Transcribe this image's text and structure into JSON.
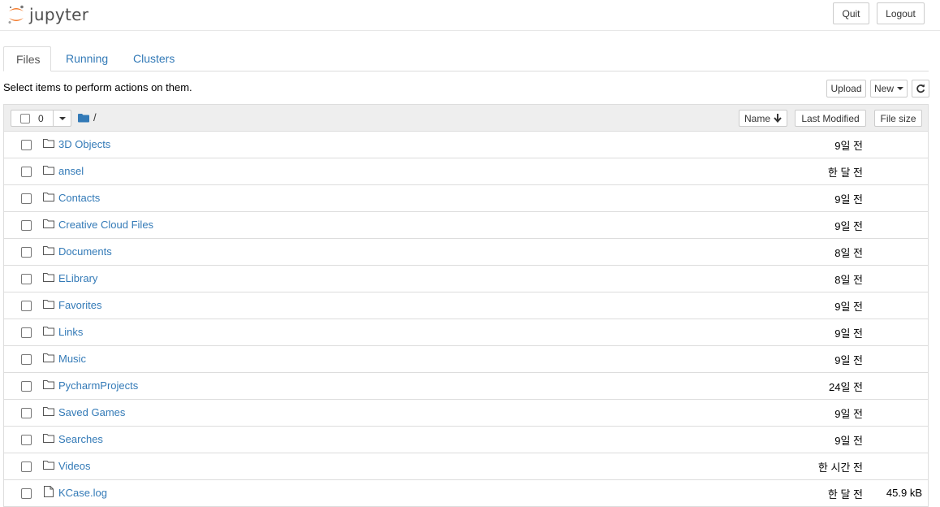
{
  "header": {
    "logo_text": "jupyter",
    "quit_label": "Quit",
    "logout_label": "Logout"
  },
  "tabs": [
    {
      "label": "Files",
      "active": true
    },
    {
      "label": "Running",
      "active": false
    },
    {
      "label": "Clusters",
      "active": false
    }
  ],
  "toolbar": {
    "hint": "Select items to perform actions on them.",
    "upload_label": "Upload",
    "new_label": "New",
    "refresh_icon": "refresh-icon"
  },
  "list_header": {
    "selected_count": "0",
    "breadcrumb": "/",
    "name_label": "Name",
    "last_modified_label": "Last Modified",
    "file_size_label": "File size"
  },
  "items": [
    {
      "name": "3D Objects",
      "type": "folder",
      "modified": "9일 전",
      "size": ""
    },
    {
      "name": "ansel",
      "type": "folder",
      "modified": "한 달 전",
      "size": ""
    },
    {
      "name": "Contacts",
      "type": "folder",
      "modified": "9일 전",
      "size": ""
    },
    {
      "name": "Creative Cloud Files",
      "type": "folder",
      "modified": "9일 전",
      "size": ""
    },
    {
      "name": "Documents",
      "type": "folder",
      "modified": "8일 전",
      "size": ""
    },
    {
      "name": "ELibrary",
      "type": "folder",
      "modified": "8일 전",
      "size": ""
    },
    {
      "name": "Favorites",
      "type": "folder",
      "modified": "9일 전",
      "size": ""
    },
    {
      "name": "Links",
      "type": "folder",
      "modified": "9일 전",
      "size": ""
    },
    {
      "name": "Music",
      "type": "folder",
      "modified": "9일 전",
      "size": ""
    },
    {
      "name": "PycharmProjects",
      "type": "folder",
      "modified": "24일 전",
      "size": ""
    },
    {
      "name": "Saved Games",
      "type": "folder",
      "modified": "9일 전",
      "size": ""
    },
    {
      "name": "Searches",
      "type": "folder",
      "modified": "9일 전",
      "size": ""
    },
    {
      "name": "Videos",
      "type": "folder",
      "modified": "한 시간 전",
      "size": ""
    },
    {
      "name": "KCase.log",
      "type": "file",
      "modified": "한 달 전",
      "size": "45.9 kB"
    }
  ],
  "colors": {
    "link": "#337ab7",
    "logo_orange": "#f37726",
    "header_bg": "#eeeeee"
  }
}
